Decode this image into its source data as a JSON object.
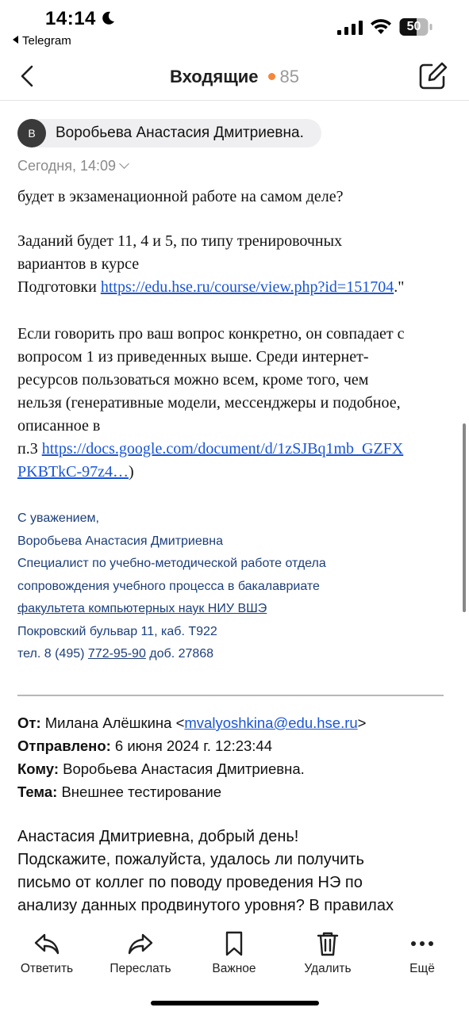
{
  "status": {
    "time": "14:14",
    "back_app": "Telegram",
    "battery": "50"
  },
  "nav": {
    "title": "Входящие",
    "unread_count": "85"
  },
  "email": {
    "sender_initial": "В",
    "sender_name": "Воробьева Анастасия Дмитриевна.",
    "date": "Сегодня, 14:09",
    "line1": "будет в экзаменационной работе на самом деле?",
    "p2_a": "Заданий будет 11, 4 и 5, по типу тренировочных",
    "p2_b": "вариантов в курсе",
    "p2_c_prefix": "Подготовки ",
    "p2_link": "https://edu.hse.ru/course/view.php?id=151704",
    "p2_suffix": ".\"",
    "p3_a": "Если говорить про ваш вопрос конкретно, он совпадает с",
    "p3_b": "вопросом 1 из приведенных выше. Среди интернет-",
    "p3_c": "ресурсов пользоваться можно всем, кроме того, чем",
    "p3_d": "нельзя (генеративные модели, мессенджеры и подобное,",
    "p3_e": "описанное в",
    "p3_f_prefix": "п.3 ",
    "p3_link_a": "https://docs.google.com/document/d/1zSJBq1mb_GZFX",
    "p3_link_b": "PKBTkC-97z4…",
    "p3_suffix": ")",
    "signature": {
      "greeting": "С уважением,",
      "name": "Воробьева Анастасия Дмитриевна",
      "position_a": "Специалист по учебно-методической работе отдела",
      "position_b": "сопровождения учебного процесса  в бакалавриате",
      "faculty": "факультета компьютерных наук НИУ ВШЭ",
      "address": "Покровский бульвар 11, каб. Т922",
      "phone_prefix": "тел. 8 (495) ",
      "phone_link": "772-95-90",
      "phone_suffix": " доб. 27868"
    },
    "quoted": {
      "from_label": "От:",
      "from_name": " Милана Алёшкина <",
      "from_email": "mvalyoshkina@edu.hse.ru",
      "from_close": ">",
      "sent_label": "Отправлено:",
      "sent_value": " 6 июня 2024 г. 12:23:44",
      "to_label": "Кому:",
      "to_value": " Воробьева Анастасия Дмитриевна.",
      "subject_label": "Тема:",
      "subject_value": " Внешнее тестирование",
      "msg_a": "Анастасия Дмитриевна, добрый день!",
      "msg_b": "Подскажите, пожалуйста, удалось ли получить",
      "msg_c": "письмо от коллег по поводу проведения НЭ по",
      "msg_d": "анализу данных продвинутого уровня? В правилах"
    }
  },
  "tabbar": {
    "reply": "Ответить",
    "forward": "Переслать",
    "important": "Важное",
    "delete": "Удалить",
    "more": "Ещё"
  },
  "colors": {
    "accent_dot": "#f5863a",
    "link": "#1a55d6",
    "signature": "#1d3f7a"
  }
}
